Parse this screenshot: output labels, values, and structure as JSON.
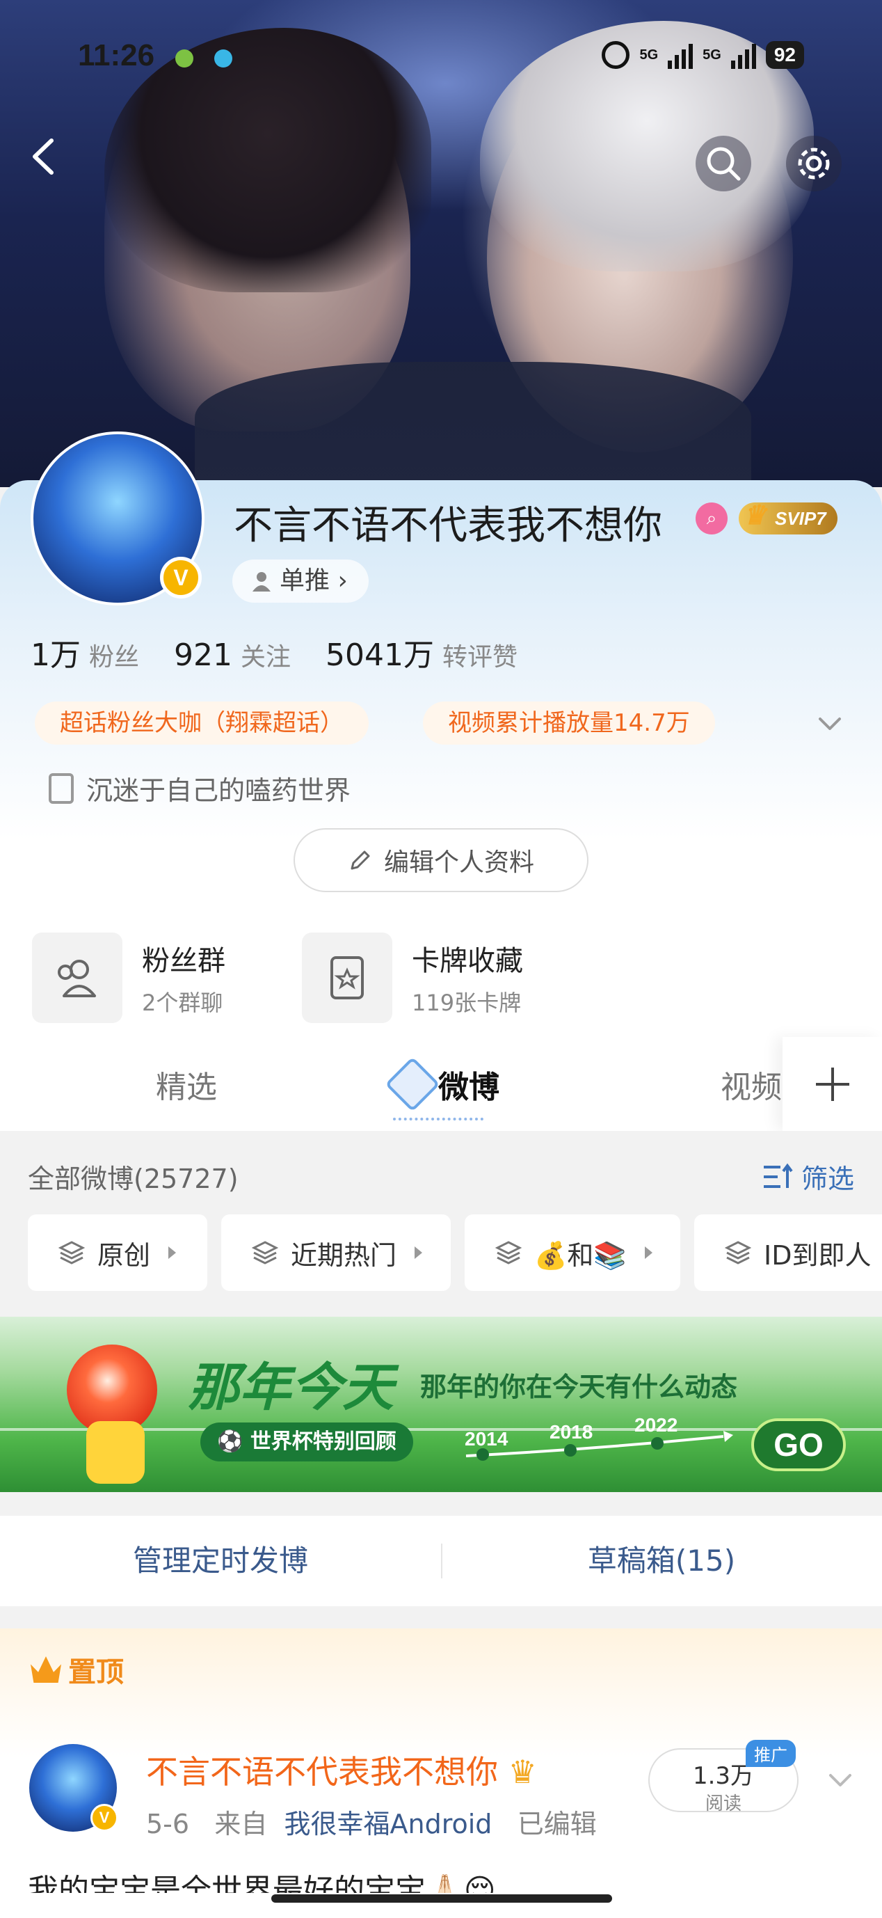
{
  "status_bar": {
    "time": "11:26",
    "signal_1": "5G",
    "signal_2": "5G",
    "battery": "92"
  },
  "profile": {
    "username": "不言不语不代表我不想你",
    "vip_label": "SVIP7",
    "tag": "单推",
    "stats": [
      {
        "value": "1万",
        "label": "粉丝"
      },
      {
        "value": "921",
        "label": "关注"
      },
      {
        "value": "5041万",
        "label": "转评赞"
      }
    ],
    "badges": [
      "超话粉丝大咖（翔霖超话）",
      "视频累计播放量14.7万"
    ],
    "bio": "沉迷于自己的嗑药世界",
    "edit_button": "编辑个人资料"
  },
  "features": [
    {
      "title": "粉丝群",
      "subtitle": "2个群聊",
      "icon": "users-icon"
    },
    {
      "title": "卡牌收藏",
      "subtitle": "119张卡牌",
      "icon": "card-icon"
    }
  ],
  "tabs": [
    {
      "label": "精选",
      "active": false
    },
    {
      "label": "微博",
      "active": true
    },
    {
      "label": "视频",
      "active": false
    }
  ],
  "feed": {
    "all_label": "全部微博(25727)",
    "filter_label": "筛选",
    "chips": [
      "原创",
      "近期热门",
      "💰和📚",
      "ID到即人"
    ]
  },
  "ad": {
    "title": "那年今天",
    "subtitle": "那年的你在今天有什么动态",
    "badge": "世界杯特别回顾",
    "years": [
      "2014",
      "2018",
      "2022"
    ],
    "go": "GO"
  },
  "manage": {
    "scheduled": "管理定时发博",
    "drafts": "草稿箱(15)"
  },
  "pinned": {
    "label": "置顶",
    "name": "不言不语不代表我不想你",
    "date": "5-6",
    "from_label": "来自",
    "source": "我很幸福Android",
    "edited": "已编辑",
    "reads_value": "1.3万",
    "reads_label": "阅读",
    "promo": "推广",
    "text": "我的宝宝是全世界最好的宝宝🙏🏻😌"
  }
}
